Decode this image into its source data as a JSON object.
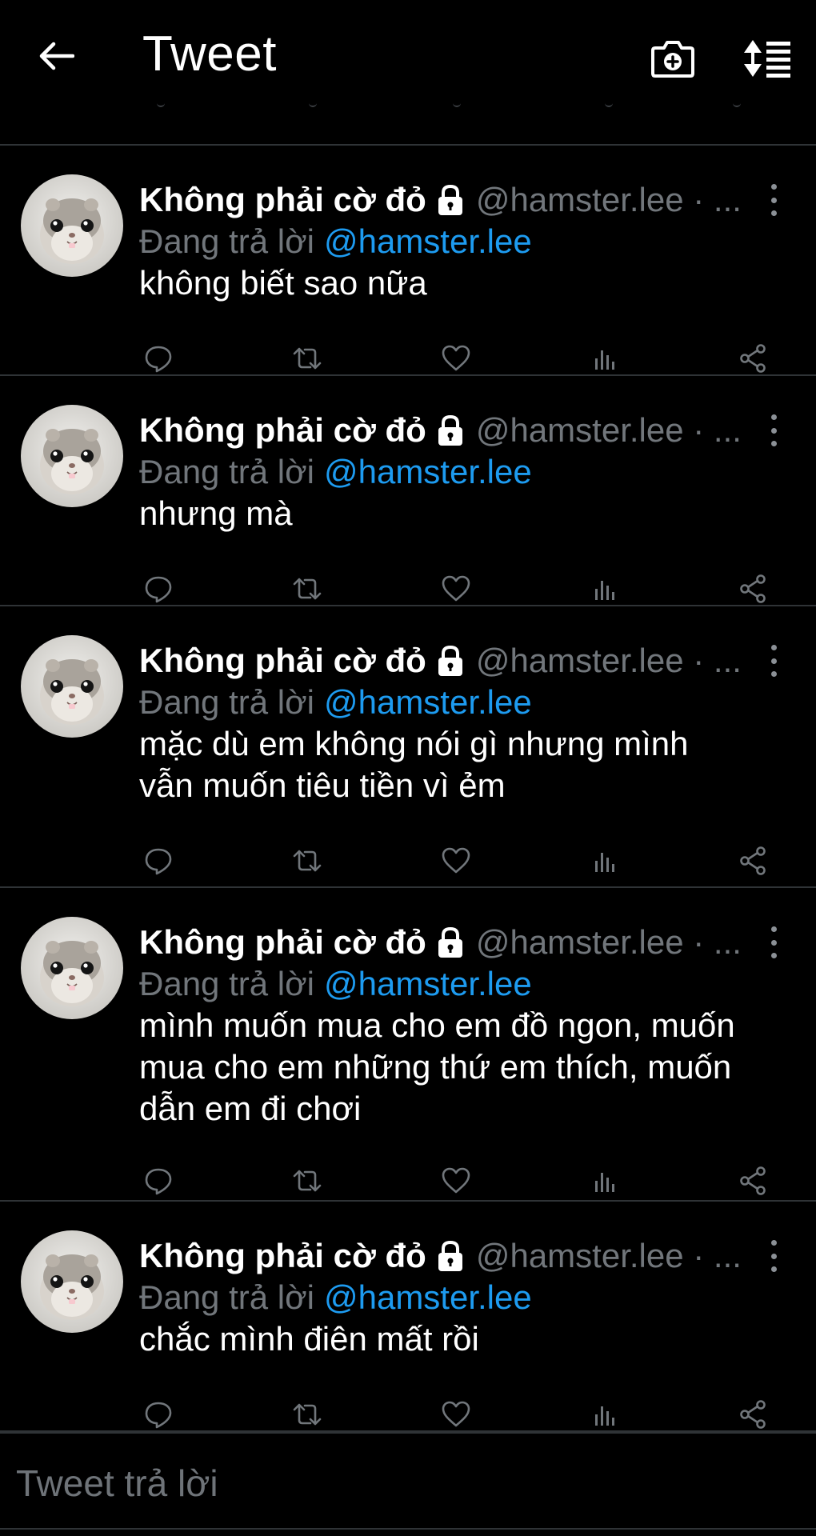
{
  "header": {
    "title": "Tweet",
    "back_icon": "arrow-left-icon",
    "camera_icon": "camera-add-icon",
    "sort_icon": "sort-list-icon"
  },
  "colors": {
    "background": "#000000",
    "divider": "#2f3336",
    "secondary_text": "#71767b",
    "mention": "#1d9bf0",
    "primary_text": "#ffffff"
  },
  "tweets": [
    {
      "name": "Không phải cờ đỏ",
      "handle": "@hamster.lee · ...",
      "reply_prefix": "Đang trả lời",
      "reply_to": "@hamster.lee",
      "lines": [
        "không biết sao nữa"
      ]
    },
    {
      "name": "Không phải cờ đỏ",
      "handle": "@hamster.lee · ...",
      "reply_prefix": "Đang trả lời",
      "reply_to": "@hamster.lee",
      "lines": [
        "nhưng mà"
      ]
    },
    {
      "name": "Không phải cờ đỏ",
      "handle": "@hamster.lee · ...",
      "reply_prefix": "Đang trả lời",
      "reply_to": "@hamster.lee",
      "lines": [
        "mặc dù em không nói gì nhưng mình",
        "vẫn muốn tiêu tiền vì ẻm"
      ]
    },
    {
      "name": "Không phải cờ đỏ",
      "handle": "@hamster.lee · ...",
      "reply_prefix": "Đang trả lời",
      "reply_to": "@hamster.lee",
      "lines": [
        "mình muốn mua cho em đồ ngon, muốn",
        "mua cho em những thứ em thích, muốn",
        "dẫn em đi chơi"
      ]
    },
    {
      "name": "Không phải cờ đỏ",
      "handle": "@hamster.lee · ...",
      "reply_prefix": "Đang trả lời",
      "reply_to": "@hamster.lee",
      "lines": [
        "chắc mình điên mất rồi"
      ]
    }
  ],
  "actions": [
    "reply-icon",
    "retweet-icon",
    "like-icon",
    "analytics-icon",
    "share-icon"
  ],
  "composer": {
    "placeholder": "Tweet trả lời"
  }
}
